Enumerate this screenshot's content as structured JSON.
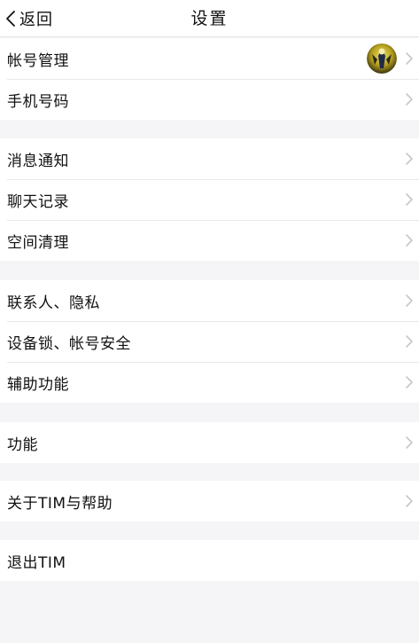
{
  "nav": {
    "back_label": "返回",
    "title": "设置"
  },
  "groups": [
    {
      "items": [
        {
          "label": "帐号管理",
          "has_avatar": true
        },
        {
          "label": "手机号码"
        }
      ]
    },
    {
      "items": [
        {
          "label": "消息通知"
        },
        {
          "label": "聊天记录"
        },
        {
          "label": "空间清理"
        }
      ]
    },
    {
      "items": [
        {
          "label": "联系人、隐私"
        },
        {
          "label": "设备锁、帐号安全"
        },
        {
          "label": "辅助功能"
        }
      ]
    },
    {
      "items": [
        {
          "label": "功能"
        }
      ]
    },
    {
      "items": [
        {
          "label": "关于TIM与帮助"
        }
      ]
    },
    {
      "items": [
        {
          "label": "退出TIM",
          "no_chevron": true
        }
      ]
    }
  ],
  "colors": {
    "background": "#f5f5f7",
    "cell": "#ffffff",
    "chevron": "#c7c7cc",
    "text": "#111111"
  },
  "icons": {
    "back": "chevron-left-icon",
    "row": "chevron-right-icon",
    "avatar": "user-avatar"
  }
}
